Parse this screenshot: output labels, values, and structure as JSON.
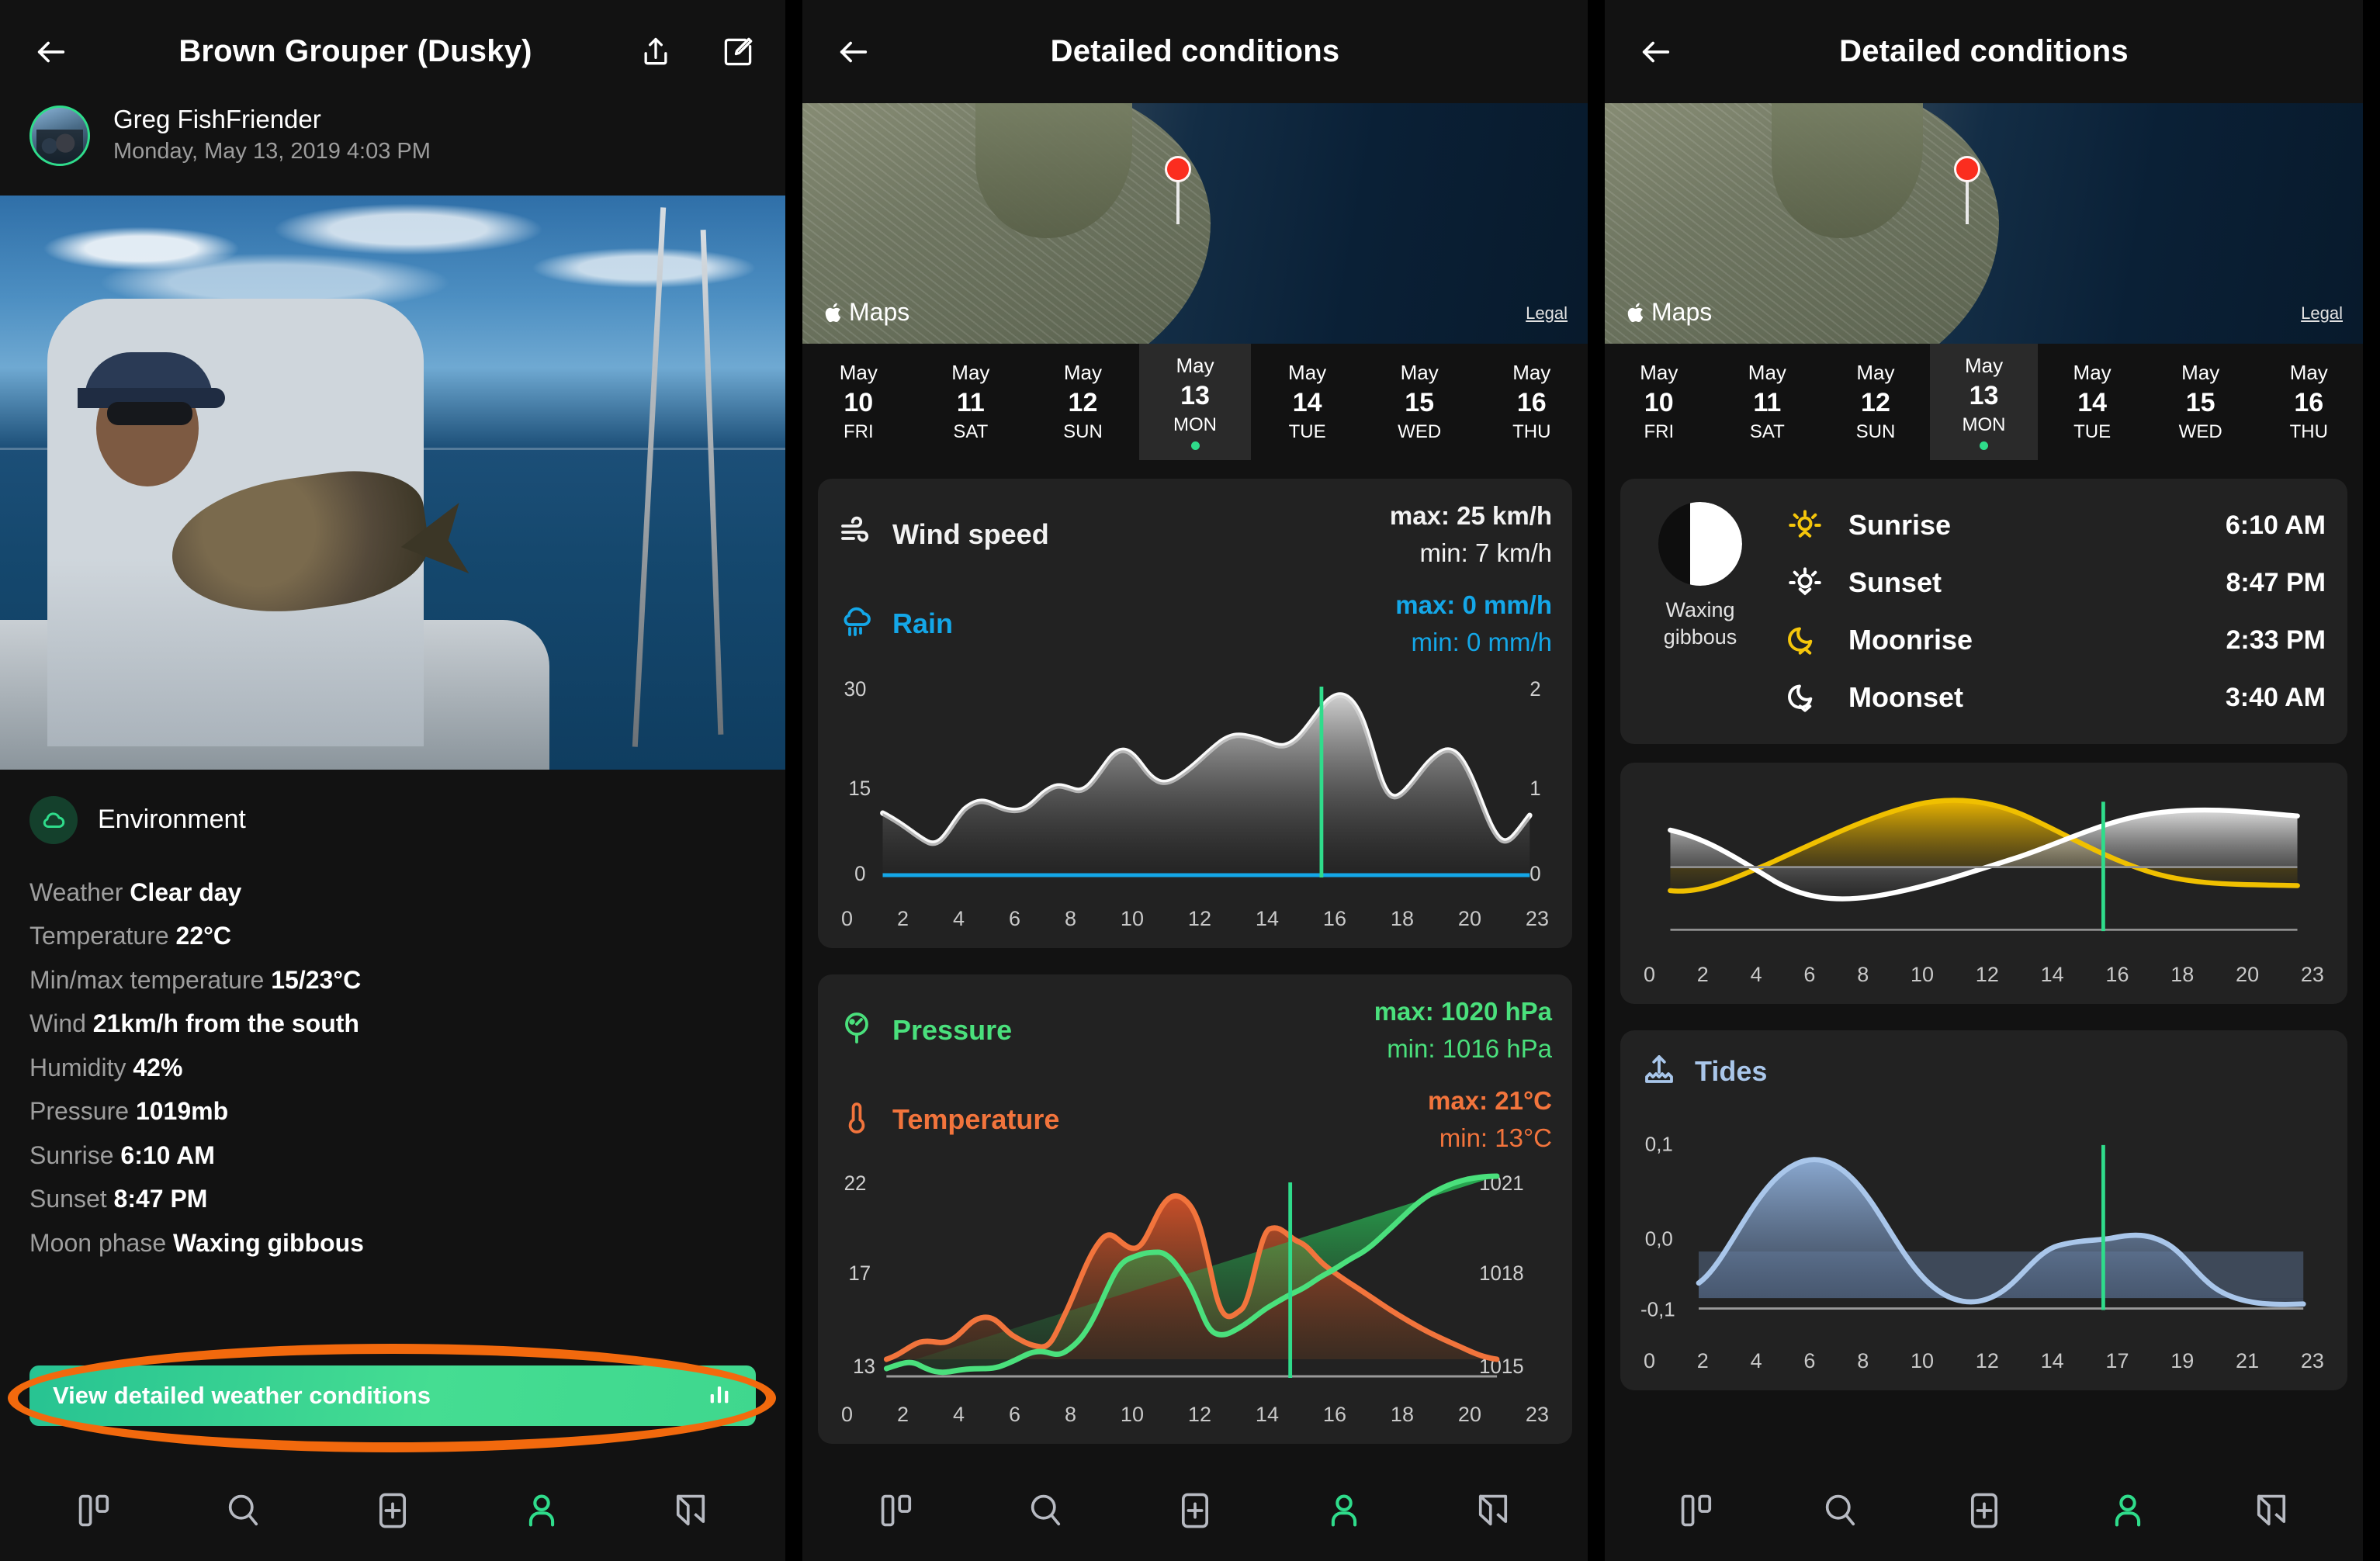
{
  "catch_screen": {
    "header": {
      "title": "Brown Grouper (Dusky)",
      "back_icon": "arrow-left-icon",
      "share_icon": "share-icon",
      "edit_icon": "edit-icon"
    },
    "user": {
      "name": "Greg FishFriender",
      "datetime": "Monday, May 13, 2019 4:03 PM"
    },
    "environment": {
      "section_title": "Environment",
      "icon": "cloud-icon",
      "rows": [
        {
          "label": "Weather ",
          "value": "Clear day"
        },
        {
          "label": "Temperature ",
          "value": "22°C"
        },
        {
          "label": "Min/max temperature ",
          "value": "15/23°C"
        },
        {
          "label": "Wind ",
          "value": "21km/h from the south"
        },
        {
          "label": "Humidity ",
          "value": "42%"
        },
        {
          "label": "Pressure ",
          "value": "1019mb"
        },
        {
          "label": "Sunrise ",
          "value": "6:10 AM"
        },
        {
          "label": "Sunset ",
          "value": "8:47 PM"
        },
        {
          "label": "Moon phase ",
          "value": "Waxing gibbous"
        }
      ]
    },
    "cta": {
      "label": "View detailed weather conditions",
      "icon": "bar-chart-icon",
      "highlight_color": "#f2690d",
      "button_color": "#3fd78e"
    }
  },
  "details_screen": {
    "header": {
      "title": "Detailed conditions",
      "back_icon": "arrow-left-icon"
    },
    "map": {
      "provider": "Maps",
      "apple_logo": "apple-icon",
      "legal": "Legal",
      "pin": "map-pin-icon"
    },
    "days": [
      {
        "month": "May",
        "num": "10",
        "dow": "FRI",
        "selected": false
      },
      {
        "month": "May",
        "num": "11",
        "dow": "SAT",
        "selected": false
      },
      {
        "month": "May",
        "num": "12",
        "dow": "SUN",
        "selected": false
      },
      {
        "month": "May",
        "num": "13",
        "dow": "MON",
        "selected": true
      },
      {
        "month": "May",
        "num": "14",
        "dow": "TUE",
        "selected": false
      },
      {
        "month": "May",
        "num": "15",
        "dow": "WED",
        "selected": false
      },
      {
        "month": "May",
        "num": "16",
        "dow": "THU",
        "selected": false
      }
    ],
    "wind_card": {
      "wind": {
        "name": "Wind speed",
        "icon": "wind-icon",
        "max": "max: 25 km/h",
        "min": "min: 7 km/h",
        "color": "#f2f2f2"
      },
      "rain": {
        "name": "Rain",
        "icon": "rain-cloud-icon",
        "max": "max: 0 mm/h",
        "min": "min: 0 mm/h",
        "color": "#14a7e8"
      }
    },
    "pressure_card": {
      "pressure": {
        "name": "Pressure",
        "icon": "gauge-icon",
        "max": "max: 1020 hPa",
        "min": "min: 1016 hPa",
        "color": "#4ae07c"
      },
      "temperature": {
        "name": "Temperature",
        "icon": "thermometer-icon",
        "max": "max: 21°C",
        "min": "min: 13°C",
        "color": "#f2743c"
      }
    }
  },
  "astro_screen": {
    "moon_phase_label": "Waxing\ngibbous",
    "moon_icon": "moon-waxing-gibbous-icon",
    "rows": [
      {
        "icon": "sunrise-icon",
        "name": "Sunrise",
        "time": "6:10 AM",
        "color": "#f5c60b"
      },
      {
        "icon": "sunset-icon",
        "name": "Sunset",
        "time": "8:47 PM",
        "color": "#ffffff"
      },
      {
        "icon": "moonrise-icon",
        "name": "Moonrise",
        "time": "2:33 PM",
        "color": "#f5c60b"
      },
      {
        "icon": "moonset-icon",
        "name": "Moonset",
        "time": "3:40 AM",
        "color": "#ffffff"
      }
    ],
    "tides_card": {
      "name": "Tides",
      "icon": "tide-icon",
      "color": "#a9c6ea"
    }
  },
  "bottom_nav": [
    {
      "icon": "dashboard-icon",
      "active": false
    },
    {
      "icon": "search-icon",
      "active": false
    },
    {
      "icon": "add-catch-icon",
      "active": false
    },
    {
      "icon": "profile-icon",
      "active": true
    },
    {
      "icon": "share-arrow-icon",
      "active": false
    }
  ],
  "chart_data": [
    {
      "type": "area",
      "title": "Wind speed / Rain",
      "xlabel": "hour",
      "x": [
        0,
        2,
        4,
        6,
        8,
        10,
        12,
        14,
        16,
        18,
        20,
        23
      ],
      "xtick_labels": [
        "0",
        "2",
        "4",
        "6",
        "8",
        "10",
        "12",
        "14",
        "16",
        "18",
        "20",
        "23"
      ],
      "series": [
        {
          "name": "Wind speed",
          "unit": "km/h",
          "color": "#f2f2f2",
          "axis": "left",
          "values": [
            13,
            9,
            14,
            13,
            15,
            18,
            16,
            19,
            21,
            20,
            23,
            25,
            22,
            17,
            16,
            19,
            17,
            10,
            8,
            13
          ]
        },
        {
          "name": "Rain",
          "unit": "mm/h",
          "color": "#14a7e8",
          "axis": "right",
          "values": [
            0,
            0,
            0,
            0,
            0,
            0,
            0,
            0,
            0,
            0,
            0,
            0,
            0,
            0,
            0,
            0,
            0,
            0,
            0,
            0
          ]
        }
      ],
      "left_axis_ticks": [
        "0",
        "15",
        "30"
      ],
      "left_ylim": [
        0,
        30
      ],
      "right_axis_ticks": [
        "0",
        "1",
        "2"
      ],
      "right_ylim": [
        0,
        2
      ],
      "marker_hour": 15.4,
      "marker_color": "#2fdc8b",
      "grid": false,
      "legend": "none"
    },
    {
      "type": "area",
      "title": "Temperature / Pressure",
      "xlabel": "hour",
      "x": [
        0,
        2,
        4,
        6,
        8,
        10,
        12,
        14,
        16,
        18,
        20,
        23
      ],
      "xtick_labels": [
        "0",
        "2",
        "4",
        "6",
        "8",
        "10",
        "12",
        "14",
        "16",
        "18",
        "20",
        "23"
      ],
      "series": [
        {
          "name": "Temperature",
          "unit": "°C",
          "color": "#f2743c",
          "axis": "left",
          "values": [
            13.2,
            13.6,
            14.1,
            14.3,
            14.6,
            14.3,
            14.4,
            14.0,
            14.5,
            16.5,
            18.6,
            18.1,
            18.5,
            20.5,
            19.2,
            19.4,
            18.8,
            18.2,
            17.4,
            16.3,
            15.2,
            14.6,
            14.2,
            14.0
          ]
        },
        {
          "name": "Pressure",
          "unit": "hPa",
          "color": "#4ae07c",
          "axis": "right",
          "values": [
            1016.0,
            1015.6,
            1015.4,
            1015.3,
            1015.3,
            1015.4,
            1015.6,
            1015.9,
            1016.3,
            1017.1,
            1017.8,
            1018.0,
            1018.1,
            1016.5,
            1016.2,
            1016.7,
            1017.1,
            1017.5,
            1017.9,
            1018.4,
            1019.2,
            1020.0,
            1020.6,
            1021.0
          ]
        }
      ],
      "left_axis_ticks": [
        "13",
        "17",
        "22"
      ],
      "left_ylim": [
        13,
        22
      ],
      "right_axis_ticks": [
        "1015",
        "1018",
        "1021"
      ],
      "right_ylim": [
        1015,
        1021
      ],
      "marker_hour": 15.4,
      "marker_color": "#2fdc8b",
      "grid": false,
      "legend": "none"
    },
    {
      "type": "line",
      "title": "Sun and Moon elevation",
      "xlabel": "hour",
      "x": [
        0,
        2,
        4,
        6,
        8,
        10,
        12,
        14,
        16,
        18,
        20,
        23
      ],
      "xtick_labels": [
        "0",
        "2",
        "4",
        "6",
        "8",
        "10",
        "12",
        "14",
        "16",
        "18",
        "20",
        "23"
      ],
      "series": [
        {
          "name": "Sun",
          "color": "#edb700",
          "values": [
            -0.62,
            -0.7,
            -0.62,
            -0.4,
            -0.05,
            0.35,
            0.72,
            0.95,
            1.0,
            0.88,
            0.6,
            0.22,
            -0.22,
            -0.55
          ]
        },
        {
          "name": "Moon",
          "color": "#ffffff",
          "values": [
            0.62,
            0.28,
            -0.12,
            -0.48,
            -0.72,
            -0.78,
            -0.62,
            -0.3,
            0.12,
            0.52,
            0.8,
            0.88,
            0.8,
            0.7
          ]
        }
      ],
      "marker_hour": 15.4,
      "marker_color": "#2fdc8b",
      "grid": false,
      "legend": "none",
      "horizon_line": true
    },
    {
      "type": "area",
      "title": "Tides",
      "xlabel": "hour",
      "ylabel": "m",
      "x": [
        0,
        2,
        4,
        6,
        8,
        10,
        17,
        19,
        21,
        23
      ],
      "xtick_labels": [
        "0",
        "2",
        "4",
        "6",
        "8",
        "10",
        "12",
        "14",
        "17",
        "19",
        "21",
        "23"
      ],
      "ytick_labels": [
        "-0,1",
        "0,0",
        "0,1"
      ],
      "ylim": [
        -0.1,
        0.1
      ],
      "series": [
        {
          "name": "Tide height",
          "color": "#a9c6ea",
          "values": [
            -0.055,
            -0.015,
            0.04,
            0.075,
            0.088,
            0.082,
            0.058,
            0.02,
            -0.025,
            -0.062,
            -0.075,
            -0.07,
            -0.045,
            -0.01,
            0.012,
            0.022,
            0.025,
            0.018,
            0.0,
            -0.03,
            -0.055,
            -0.07,
            -0.075,
            -0.072
          ]
        }
      ],
      "marker_hour": 15.8,
      "marker_color": "#2fdc8b",
      "grid": false,
      "legend": "none"
    }
  ]
}
